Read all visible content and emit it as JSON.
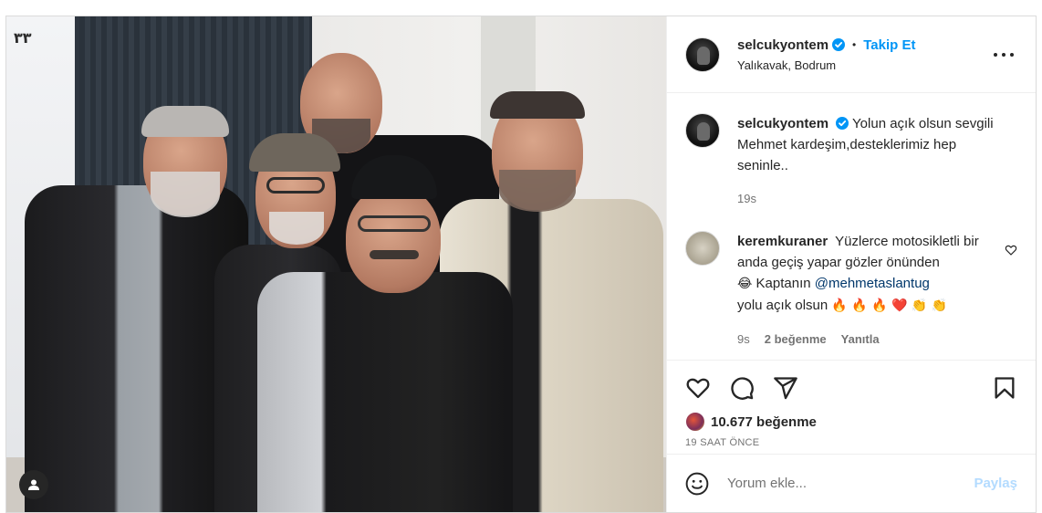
{
  "post": {
    "author": {
      "username": "selcukyontem",
      "verified": true,
      "follow_label": "Takip Et",
      "separator": "•",
      "location": "Yalıkavak, Bodrum"
    },
    "photo": {
      "watermark": "۳۳"
    },
    "caption": {
      "username": "selcukyontem",
      "text": "Yolun açık olsun sevgili Mehmet kardeşim,desteklerimiz hep seninle..",
      "time": "19s"
    },
    "comments": [
      {
        "username": "keremkuraner",
        "text_1": "Yüzlerce motosikletli bir anda geçiş yapar gözler önünden",
        "emoji_1": "😂",
        "text_2": " Kaptanın ",
        "mention": "@mehmetaslantug",
        "text_3": "yolu açık olsun ",
        "emoji_2": "🔥 🔥 🔥 ❤️ 👏 👏",
        "time": "9s",
        "likes": "2 beğenme",
        "reply": "Yanıtla"
      }
    ],
    "likes_count": "10.677 beğenme",
    "time_ago": "19 SAAT ÖNCE",
    "add_comment": {
      "placeholder": "Yorum ekle...",
      "share_label": "Paylaş"
    }
  },
  "icons": [
    "heart-icon",
    "comment-icon",
    "share-icon",
    "bookmark-icon",
    "emoji-icon",
    "more-icon",
    "verified-icon",
    "user-tag-icon"
  ],
  "colors": {
    "accent": "#0095f6",
    "share_disabled": "#b3dbff",
    "verified": "#0095f6",
    "muted": "#737373",
    "text": "#262626",
    "border": "#dbdbdb"
  }
}
